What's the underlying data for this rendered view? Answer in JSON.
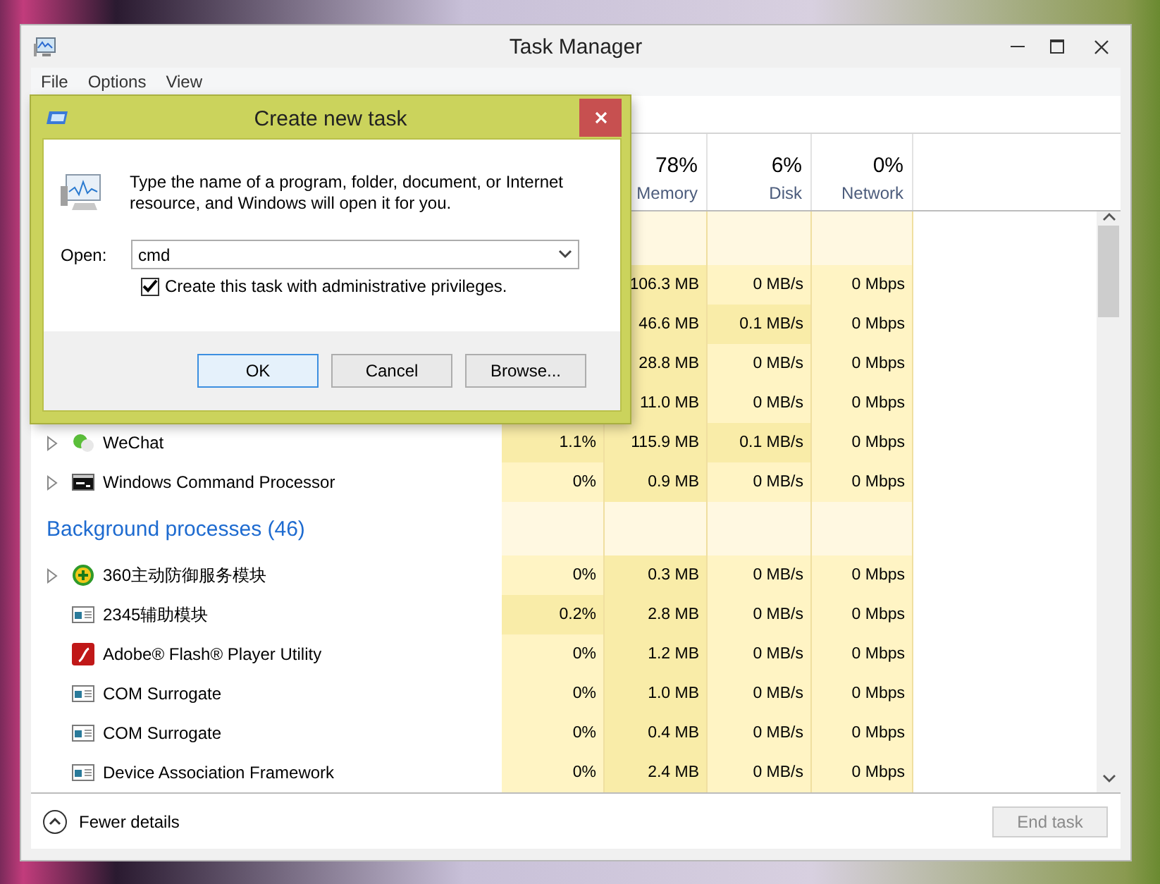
{
  "window": {
    "title": "Task Manager",
    "menu": [
      "File",
      "Options",
      "View"
    ]
  },
  "columns": [
    {
      "total": "78%",
      "label": "Memory"
    },
    {
      "total": "6%",
      "label": "Disk"
    },
    {
      "total": "0%",
      "label": "Network"
    }
  ],
  "rows": [
    {
      "kind": "group"
    },
    {
      "kind": "covered",
      "memory": {
        "text": "106.3 MB",
        "highlighted": true
      },
      "disk": {
        "text": "0 MB/s",
        "highlighted": false
      },
      "network": {
        "text": "0 Mbps",
        "highlighted": false
      }
    },
    {
      "kind": "covered",
      "memory": {
        "text": "46.6 MB",
        "highlighted": true
      },
      "disk": {
        "text": "0.1 MB/s",
        "highlighted": true
      },
      "network": {
        "text": "0 Mbps",
        "highlighted": false
      }
    },
    {
      "kind": "covered",
      "memory": {
        "text": "28.8 MB",
        "highlighted": true
      },
      "disk": {
        "text": "0 MB/s",
        "highlighted": false
      },
      "network": {
        "text": "0 Mbps",
        "highlighted": false
      }
    },
    {
      "kind": "covered",
      "memory": {
        "text": "11.0 MB",
        "highlighted": true
      },
      "disk": {
        "text": "0 MB/s",
        "highlighted": false
      },
      "network": {
        "text": "0 Mbps",
        "highlighted": false
      }
    },
    {
      "kind": "chat",
      "expandable": true,
      "name": "WeChat",
      "cpu": {
        "text": "1.1%",
        "highlighted": true
      },
      "memory": {
        "text": "115.9 MB",
        "highlighted": true
      },
      "disk": {
        "text": "0.1 MB/s",
        "highlighted": true
      },
      "network": {
        "text": "0 Mbps",
        "highlighted": false
      }
    },
    {
      "kind": "console",
      "expandable": true,
      "name": "Windows Command Processor",
      "cpu": {
        "text": "0%",
        "highlighted": false
      },
      "memory": {
        "text": "0.9 MB",
        "highlighted": true
      },
      "disk": {
        "text": "0 MB/s",
        "highlighted": false
      },
      "network": {
        "text": "0 Mbps",
        "highlighted": false
      }
    },
    {
      "kind": "group",
      "title": "Background processes (46)"
    },
    {
      "kind": "shield",
      "expandable": true,
      "name": "360主动防御服务模块",
      "cpu": {
        "text": "0%",
        "highlighted": false
      },
      "memory": {
        "text": "0.3 MB",
        "highlighted": true
      },
      "disk": {
        "text": "0 MB/s",
        "highlighted": false
      },
      "network": {
        "text": "0 Mbps",
        "highlighted": false
      }
    },
    {
      "kind": "window",
      "expandable": false,
      "name": "2345辅助模块",
      "cpu": {
        "text": "0.2%",
        "highlighted": true
      },
      "memory": {
        "text": "2.8 MB",
        "highlighted": true
      },
      "disk": {
        "text": "0 MB/s",
        "highlighted": false
      },
      "network": {
        "text": "0 Mbps",
        "highlighted": false
      }
    },
    {
      "kind": "flash",
      "expandable": false,
      "name": "Adobe® Flash® Player Utility",
      "cpu": {
        "text": "0%",
        "highlighted": false
      },
      "memory": {
        "text": "1.2 MB",
        "highlighted": true
      },
      "disk": {
        "text": "0 MB/s",
        "highlighted": false
      },
      "network": {
        "text": "0 Mbps",
        "highlighted": false
      }
    },
    {
      "kind": "window",
      "expandable": false,
      "name": "COM Surrogate",
      "cpu": {
        "text": "0%",
        "highlighted": false
      },
      "memory": {
        "text": "1.0 MB",
        "highlighted": true
      },
      "disk": {
        "text": "0 MB/s",
        "highlighted": false
      },
      "network": {
        "text": "0 Mbps",
        "highlighted": false
      }
    },
    {
      "kind": "window",
      "expandable": false,
      "name": "COM Surrogate",
      "cpu": {
        "text": "0%",
        "highlighted": false
      },
      "memory": {
        "text": "0.4 MB",
        "highlighted": true
      },
      "disk": {
        "text": "0 MB/s",
        "highlighted": false
      },
      "network": {
        "text": "0 Mbps",
        "highlighted": false
      }
    },
    {
      "kind": "window",
      "expandable": false,
      "name": "Device Association Framework",
      "cpu": {
        "text": "0%",
        "highlighted": false
      },
      "memory": {
        "text": "2.4 MB",
        "highlighted": true
      },
      "disk": {
        "text": "0 MB/s",
        "highlighted": false
      },
      "network": {
        "text": "0 Mbps",
        "highlighted": false
      }
    }
  ],
  "footer": {
    "details": "Fewer details",
    "end_task": {
      "label": "End task",
      "disabled": true
    }
  },
  "dialog": {
    "title": "Create new task",
    "message": "Type the name of a program, folder, document, or Internet resource, and Windows will open it for you.",
    "open_label": "Open:",
    "value": "cmd",
    "admin": {
      "label": "Create this task with administrative privileges.",
      "checked": true
    },
    "buttons": [
      {
        "label": "OK",
        "default": true
      },
      {
        "label": "Cancel",
        "default": false
      },
      {
        "label": "Browse...",
        "default": false
      }
    ]
  }
}
